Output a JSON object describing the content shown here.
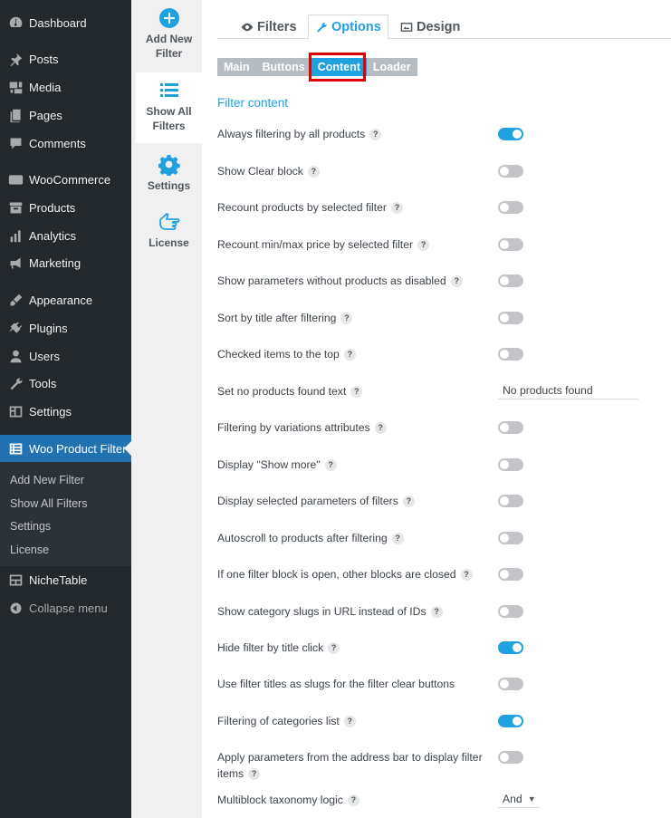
{
  "sidebar": {
    "items": [
      {
        "name": "dashboard",
        "icon": "dashboard-icon",
        "label": "Dashboard"
      },
      {
        "name": "posts",
        "icon": "pushpin-icon",
        "label": "Posts"
      },
      {
        "name": "media",
        "icon": "media-icon",
        "label": "Media"
      },
      {
        "name": "pages",
        "icon": "pages-icon",
        "label": "Pages"
      },
      {
        "name": "comments",
        "icon": "comment-icon",
        "label": "Comments"
      },
      {
        "name": "woocommerce",
        "icon": "woo-icon",
        "label": "WooCommerce"
      },
      {
        "name": "products",
        "icon": "archive-icon",
        "label": "Products"
      },
      {
        "name": "analytics",
        "icon": "bar-chart-icon",
        "label": "Analytics"
      },
      {
        "name": "marketing",
        "icon": "megaphone-icon",
        "label": "Marketing"
      },
      {
        "name": "appearance",
        "icon": "brush-icon",
        "label": "Appearance"
      },
      {
        "name": "plugins",
        "icon": "plug-icon",
        "label": "Plugins"
      },
      {
        "name": "users",
        "icon": "user-icon",
        "label": "Users"
      },
      {
        "name": "tools",
        "icon": "wrench-icon",
        "label": "Tools"
      },
      {
        "name": "settings",
        "icon": "settings-icon",
        "label": "Settings"
      },
      {
        "name": "woo-product-filter",
        "icon": "list-icon",
        "label": "Woo Product Filter"
      },
      {
        "name": "nichetable",
        "icon": "table-icon",
        "label": "NicheTable"
      },
      {
        "name": "collapse-menu",
        "icon": "collapse-icon",
        "label": "Collapse menu"
      }
    ],
    "submenu": [
      "Add New Filter",
      "Show All Filters",
      "Settings",
      "License"
    ]
  },
  "plugin_tabs": [
    {
      "icon": "plus-circle-icon",
      "label": "Add New Filter"
    },
    {
      "icon": "list-icon",
      "label": "Show All Filters"
    },
    {
      "icon": "gear-icon",
      "label": "Settings"
    },
    {
      "icon": "hand-pointer-icon",
      "label": "License"
    }
  ],
  "top_tabs": [
    {
      "icon": "eye-icon",
      "label": "Filters"
    },
    {
      "icon": "wrench-icon",
      "label": "Options"
    },
    {
      "icon": "image-icon",
      "label": "Design"
    }
  ],
  "sub_tabs": [
    "Main",
    "Buttons",
    "Content",
    "Loader"
  ],
  "section_title": "Filter content",
  "help_glyph": "?",
  "options": [
    {
      "label": "Always filtering by all products",
      "control": "toggle",
      "on": true
    },
    {
      "label": "Show Clear block",
      "control": "toggle",
      "on": false
    },
    {
      "label": "Recount products by selected filter",
      "control": "toggle",
      "on": false
    },
    {
      "label": "Recount min/max price by selected filter",
      "control": "toggle",
      "on": false
    },
    {
      "label": "Show parameters without products as disabled",
      "control": "toggle",
      "on": false
    },
    {
      "label": "Sort by title after filtering",
      "control": "toggle",
      "on": false
    },
    {
      "label": "Checked items to the top",
      "control": "toggle",
      "on": false
    },
    {
      "label": "Set no products found text",
      "control": "text",
      "value": "No products found"
    },
    {
      "label": "Filtering by variations attributes",
      "control": "toggle",
      "on": false
    },
    {
      "label": "Display \"Show more\"",
      "control": "toggle",
      "on": false
    },
    {
      "label": "Display selected parameters of filters",
      "control": "toggle",
      "on": false
    },
    {
      "label": "Autoscroll to products after filtering",
      "control": "toggle",
      "on": false
    },
    {
      "label": "If one filter block is open, other blocks are closed",
      "control": "toggle",
      "on": false
    },
    {
      "label": "Show category slugs in URL instead of IDs",
      "control": "toggle",
      "on": false
    },
    {
      "label": "Hide filter by title click",
      "control": "toggle",
      "on": true
    },
    {
      "label": "Use filter titles as slugs for the filter clear buttons",
      "control": "toggle",
      "on": false,
      "no_help": true
    },
    {
      "label": "Filtering of categories list",
      "control": "toggle",
      "on": true
    },
    {
      "label": "Apply parameters from the address bar to display filter items",
      "control": "toggle",
      "on": false
    },
    {
      "label": "Multiblock taxonomy logic",
      "control": "select",
      "value": "And"
    }
  ],
  "colors": {
    "accent": "#1fa1e0",
    "wp_active": "#2271b1",
    "highlight": "#e00000"
  }
}
